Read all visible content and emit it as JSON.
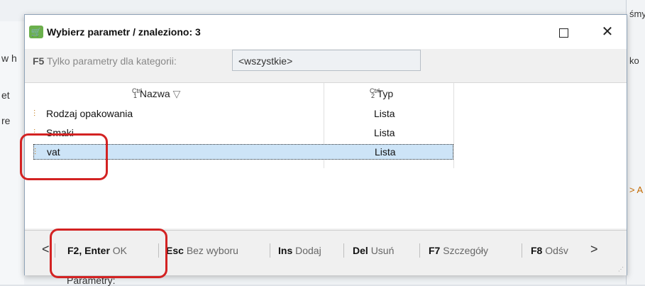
{
  "background": {
    "left_texts": [
      "w h",
      "et",
      "re"
    ],
    "right_texts": [
      "śmy",
      "ko",
      "> A"
    ],
    "bottom_text": "Parametry:"
  },
  "dialog": {
    "title": "Wybierz parametr / znaleziono: 3",
    "maximize_icon": "maximize-icon",
    "close_label": "✕"
  },
  "filter": {
    "key": "F5",
    "label": "Tylko parametry dla kategorii:",
    "value": "<wszystkie>"
  },
  "grid": {
    "columns": [
      {
        "ctrl": "Ctrl",
        "num": "1",
        "label": "Nazwa",
        "sort_icon": "▽"
      },
      {
        "ctrl": "Ctrl",
        "num": "2",
        "label": "Typ"
      }
    ],
    "rows": [
      {
        "name": "Rodzaj opakowania",
        "type": "Lista",
        "selected": false
      },
      {
        "name": "Smaki",
        "type": "Lista",
        "selected": false
      },
      {
        "name": "vat",
        "type": "Lista",
        "selected": true
      }
    ]
  },
  "footer": {
    "prev": "<",
    "next": ">",
    "buttons": [
      {
        "key": "F2, Enter",
        "action": "OK"
      },
      {
        "key": "Esc",
        "action": "Bez wyboru"
      },
      {
        "key": "Ins",
        "action": "Dodaj"
      },
      {
        "key": "Del",
        "action": "Usuń"
      },
      {
        "key": "F7",
        "action": "Szczegóły"
      },
      {
        "key": "F8",
        "action": "Odśv"
      }
    ]
  },
  "colors": {
    "selected_row": "#cde4f7",
    "annotation": "#d32222"
  }
}
